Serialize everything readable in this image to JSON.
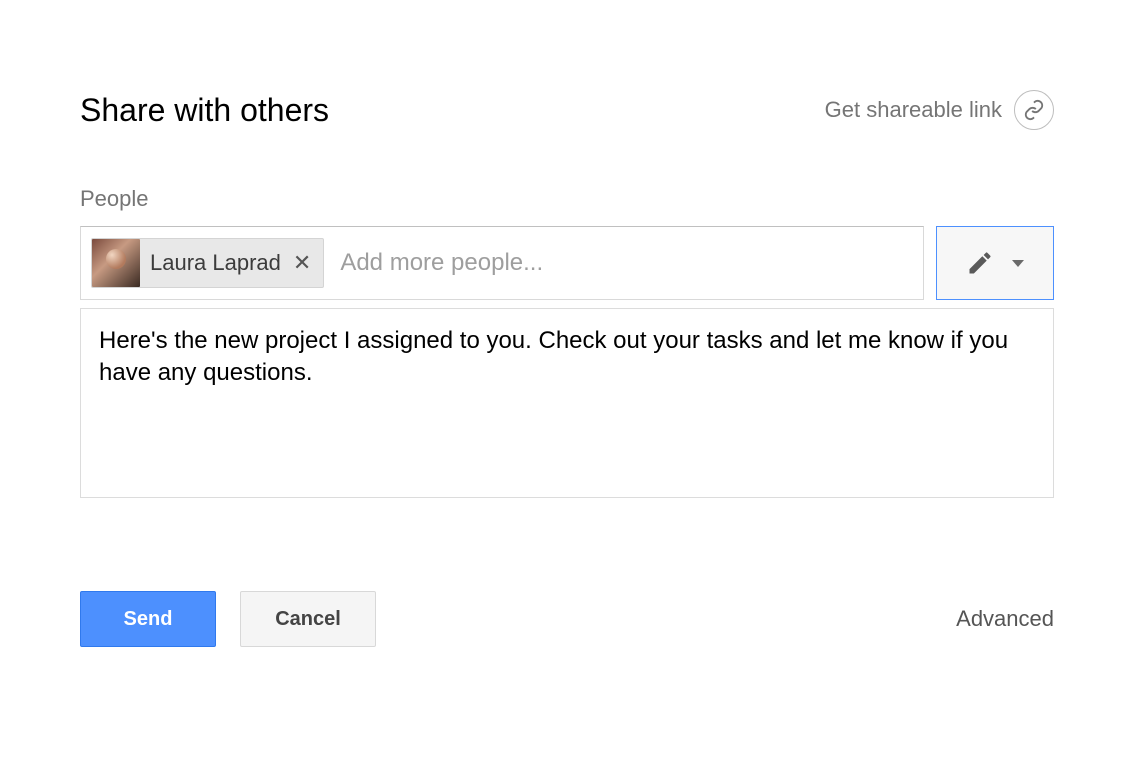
{
  "header": {
    "title": "Share with others",
    "shareable_link_label": "Get shareable link"
  },
  "people": {
    "section_label": "People",
    "chips": [
      {
        "name": "Laura Laprad"
      }
    ],
    "input_placeholder": "Add more people...",
    "permission_icon": "pencil-icon"
  },
  "note": {
    "value": "Here's the new project I assigned to you. Check out your tasks and let me know if you have any questions."
  },
  "footer": {
    "send_label": "Send",
    "cancel_label": "Cancel",
    "advanced_label": "Advanced"
  }
}
